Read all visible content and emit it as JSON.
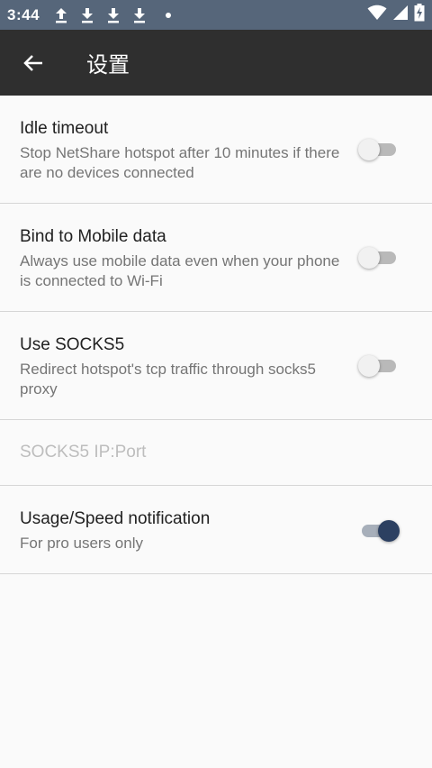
{
  "status_bar": {
    "time": "3:44",
    "icons": [
      "upload-arrow-icon",
      "download-arrow-icon",
      "download-arrow-icon",
      "download-arrow-icon",
      "notification-dot-icon",
      "wifi-icon",
      "signal-icon",
      "battery-icon"
    ]
  },
  "app_bar": {
    "back_icon": "arrow-back-icon",
    "title": "设置"
  },
  "settings": {
    "idle_timeout": {
      "title": "Idle timeout",
      "summary": "Stop NetShare hotspot after 10 minutes if there are no devices connected",
      "enabled": false
    },
    "bind_mobile": {
      "title": "Bind to Mobile data",
      "summary": "Always use mobile data even when your phone is connected to Wi-Fi",
      "enabled": false
    },
    "use_socks5": {
      "title": "Use SOCKS5",
      "summary": "Redirect hotspot's tcp traffic through socks5 proxy",
      "enabled": false
    },
    "socks5_addr": {
      "label": "SOCKS5 IP:Port"
    },
    "usage_notification": {
      "title": "Usage/Speed notification",
      "summary": "For pro users only",
      "enabled": true
    }
  },
  "colors": {
    "status_bar": "#56667a",
    "app_bar": "#2f2f2f",
    "accent": "#2c4061",
    "background": "#fafafa"
  }
}
